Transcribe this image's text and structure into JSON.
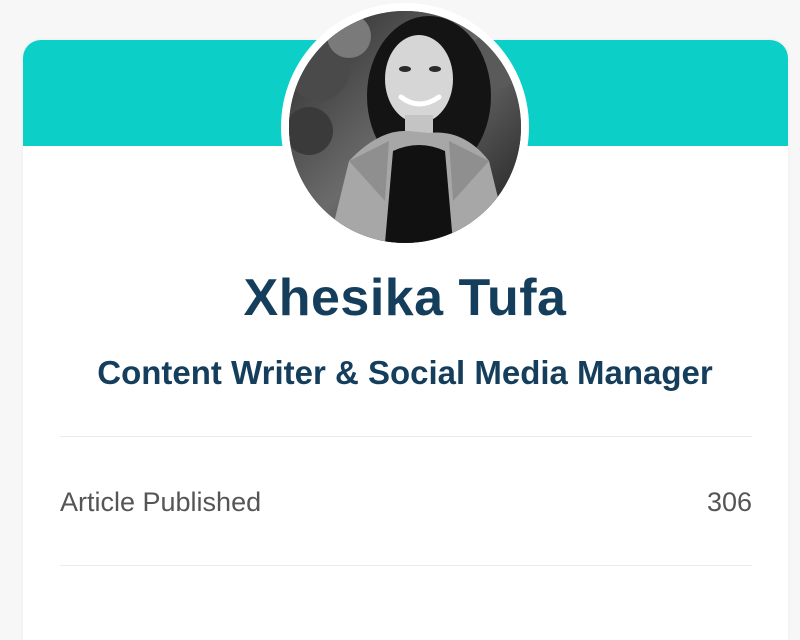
{
  "profile": {
    "name": "Xhesika Tufa",
    "role": "Content Writer & Social Media Manager"
  },
  "stats": [
    {
      "label": "Article Published",
      "value": "306"
    }
  ],
  "colors": {
    "banner": "#0ccfc8",
    "heading": "#153e5c",
    "stat_text": "#555555",
    "divider": "#ebebeb"
  },
  "icons": {
    "avatar": "profile-photo"
  }
}
